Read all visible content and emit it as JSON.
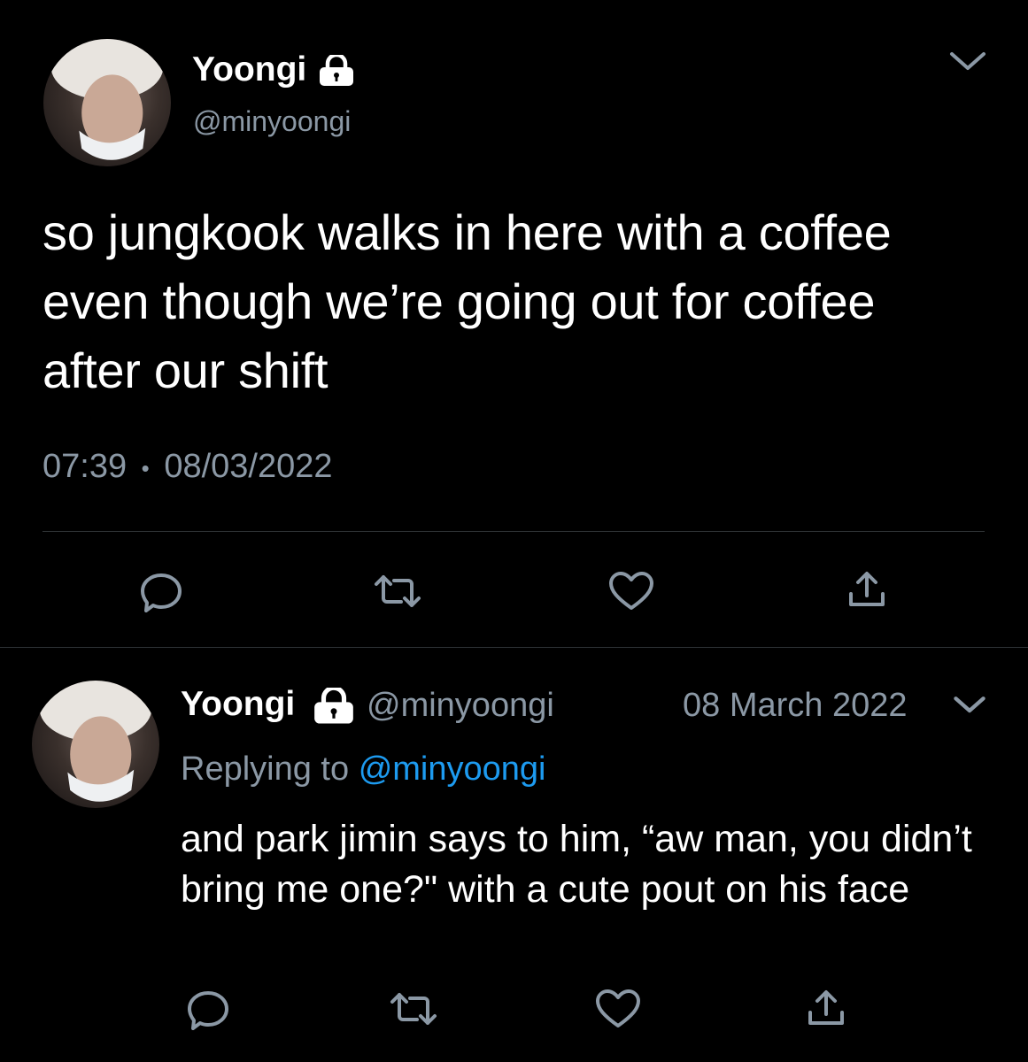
{
  "main_tweet": {
    "display_name": "Yoongi",
    "handle": "@minyoongi",
    "text": "so jungkook walks in here with a coffee even though we’re going out for coffee after our shift",
    "time": "07:39",
    "separator": "•",
    "date": "08/03/2022",
    "icons": [
      "lock-icon",
      "chevron-down-icon",
      "reply-icon",
      "retweet-icon",
      "like-icon",
      "share-icon"
    ]
  },
  "reply_tweet": {
    "display_name": "Yoongi",
    "handle": "@minyoongi",
    "date": "08 March 2022",
    "replying_prefix": "Replying to",
    "replying_handle": "@minyoongi",
    "text": "and park jimin says to him, “aw man, you didn’t bring me one?\" with a cute pout on his face",
    "icons": [
      "lock-icon",
      "chevron-down-icon",
      "reply-icon",
      "retweet-icon",
      "like-icon",
      "share-icon"
    ]
  },
  "colors": {
    "background": "#000000",
    "text": "#ffffff",
    "muted": "#8b98a5",
    "link": "#1d9bf0",
    "divider": "#2f3336"
  }
}
